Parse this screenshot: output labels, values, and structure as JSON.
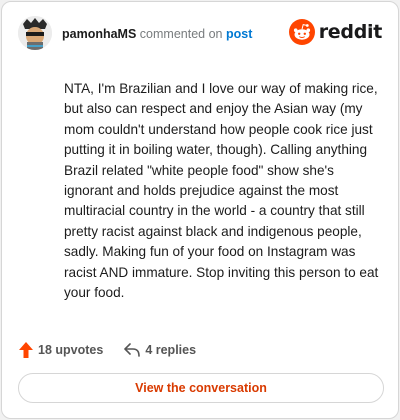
{
  "header": {
    "username": "pamonhaMS",
    "action_text": "commented on",
    "post_link_text": "post",
    "brand_name": "reddit"
  },
  "comment": {
    "text": "NTA, I'm Brazilian and I love our way of making rice, but also can respect and enjoy the Asian way (my mom couldn't understand how people cook rice just putting it in boiling water, though). Calling anything Brazil related \"white people food\" show she's ignorant and holds prejudice against the most multiracial country in the world - a country that still pretty racist against black and indigenous people, sadly. Making fun of your food on Instagram was racist AND immature. Stop inviting this person to eat your food."
  },
  "footer": {
    "upvotes_label": "18 upvotes",
    "replies_label": "4 replies",
    "view_button_label": "View the conversation"
  },
  "colors": {
    "accent": "#ff4500",
    "link": "#0079d3",
    "button_text": "#d93a00"
  },
  "icons": {
    "avatar": "avatar-icon",
    "brand": "reddit-logo-icon",
    "upvote": "upvote-arrow-icon",
    "reply": "reply-arrow-icon"
  }
}
